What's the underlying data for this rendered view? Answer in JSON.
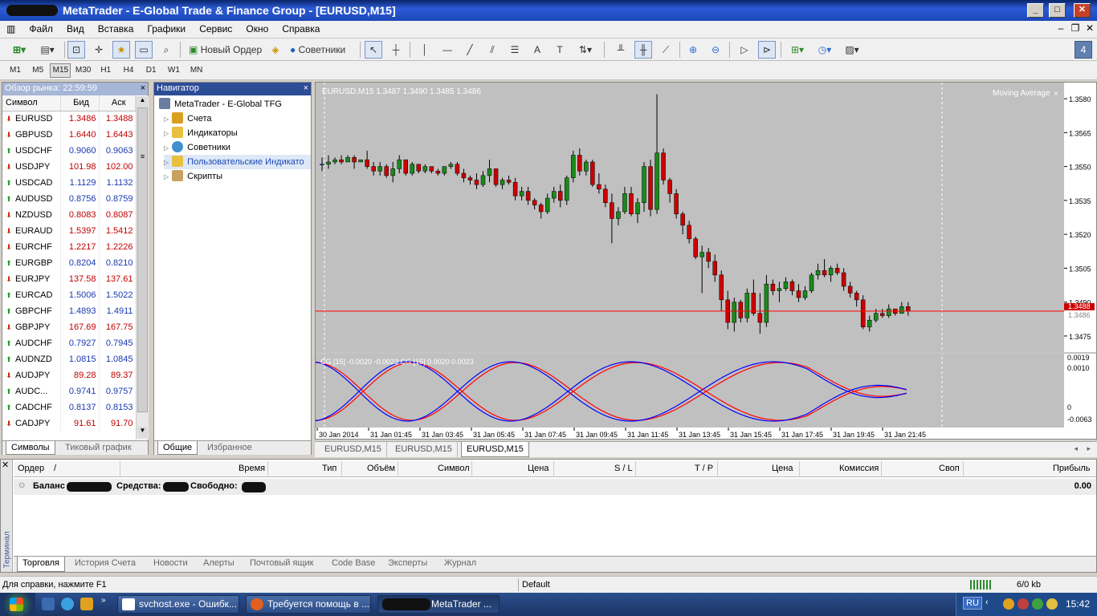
{
  "window": {
    "title": "MetaTrader - E-Global Trade & Finance Group - [EURUSD,M15]",
    "buttons": [
      "_",
      "□",
      "✕"
    ]
  },
  "menu": {
    "items": [
      "Файл",
      "Вид",
      "Вставка",
      "Графики",
      "Сервис",
      "Окно",
      "Справка"
    ],
    "mdi": [
      "–",
      "❐",
      "✕"
    ]
  },
  "toolbar": {
    "new_order": "Новый Ордер",
    "experts": "Советники",
    "badge": "4"
  },
  "periods": [
    "M1",
    "M5",
    "M15",
    "M30",
    "H1",
    "H4",
    "D1",
    "W1",
    "MN"
  ],
  "active_period": "M15",
  "market_watch": {
    "title": "Обзор рынка: 22:59:59",
    "close": "×",
    "columns": [
      "Символ",
      "Бид",
      "Аск"
    ],
    "rows": [
      {
        "dir": "down",
        "symbol": "EURUSD",
        "bid": "1.3486",
        "ask": "1.3488"
      },
      {
        "dir": "down",
        "symbol": "GBPUSD",
        "bid": "1.6440",
        "ask": "1.6443"
      },
      {
        "dir": "up",
        "symbol": "USDCHF",
        "bid": "0.9060",
        "ask": "0.9063"
      },
      {
        "dir": "down",
        "symbol": "USDJPY",
        "bid": "101.98",
        "ask": "102.00"
      },
      {
        "dir": "up",
        "symbol": "USDCAD",
        "bid": "1.1129",
        "ask": "1.1132"
      },
      {
        "dir": "up",
        "symbol": "AUDUSD",
        "bid": "0.8756",
        "ask": "0.8759"
      },
      {
        "dir": "down",
        "symbol": "NZDUSD",
        "bid": "0.8083",
        "ask": "0.8087"
      },
      {
        "dir": "down",
        "symbol": "EURAUD",
        "bid": "1.5397",
        "ask": "1.5412"
      },
      {
        "dir": "down",
        "symbol": "EURCHF",
        "bid": "1.2217",
        "ask": "1.2226"
      },
      {
        "dir": "up",
        "symbol": "EURGBP",
        "bid": "0.8204",
        "ask": "0.8210"
      },
      {
        "dir": "down",
        "symbol": "EURJPY",
        "bid": "137.58",
        "ask": "137.61"
      },
      {
        "dir": "up",
        "symbol": "EURCAD",
        "bid": "1.5006",
        "ask": "1.5022"
      },
      {
        "dir": "up",
        "symbol": "GBPCHF",
        "bid": "1.4893",
        "ask": "1.4911"
      },
      {
        "dir": "down",
        "symbol": "GBPJPY",
        "bid": "167.69",
        "ask": "167.75"
      },
      {
        "dir": "up",
        "symbol": "AUDCHF",
        "bid": "0.7927",
        "ask": "0.7945"
      },
      {
        "dir": "up",
        "symbol": "AUDNZD",
        "bid": "1.0815",
        "ask": "1.0845"
      },
      {
        "dir": "down",
        "symbol": "AUDJPY",
        "bid": "89.28",
        "ask": "89.37"
      },
      {
        "dir": "up",
        "symbol": "AUDC...",
        "bid": "0.9741",
        "ask": "0.9757"
      },
      {
        "dir": "up",
        "symbol": "CADCHF",
        "bid": "0.8137",
        "ask": "0.8153"
      },
      {
        "dir": "down",
        "symbol": "CADJPY",
        "bid": "91.61",
        "ask": "91.70"
      }
    ],
    "tabs": [
      "Символы",
      "Тиковый график"
    ]
  },
  "navigator": {
    "title": "Навигатор",
    "close": "×",
    "root": "MetaTrader - E-Global TFG",
    "items": [
      "Счета",
      "Индикаторы",
      "Советники",
      "Пользовательские Индикато",
      "Скрипты"
    ],
    "tabs": [
      "Общие",
      "Избранное"
    ]
  },
  "chart": {
    "header": "EURUSD,M15  1.3487 1.3490 1.3485 1.3486",
    "indicator_label": "Moving Average",
    "osc_label": "CG [15] -0.0020 -0.0023  CG [15] 0.0020 0.0023",
    "price_ticks": [
      "1.3580",
      "1.3565",
      "1.3550",
      "1.3535",
      "1.3520",
      "1.3505",
      "1.3490",
      "1.3475"
    ],
    "bid_label": "1.3488",
    "ask_label": "1.3486",
    "osc_ticks": [
      "0.0019",
      "0.0010",
      "0",
      "-0.0063"
    ],
    "time_ticks": [
      "30 Jan 2014",
      "31 Jan 01:45",
      "31 Jan 03:45",
      "31 Jan 05:45",
      "31 Jan 07:45",
      "31 Jan 09:45",
      "31 Jan 11:45",
      "31 Jan 13:45",
      "31 Jan 15:45",
      "31 Jan 17:45",
      "31 Jan 19:45",
      "31 Jan 21:45"
    ],
    "colors": {
      "bull": "#1a8a1a",
      "bear": "#cc0000",
      "bg": "#c0c0c0",
      "osc_red": "#ff0000",
      "osc_blue": "#0000ff",
      "bidline": "#ff0000"
    }
  },
  "chart_data": {
    "type": "candlestick",
    "symbol": "EURUSD",
    "timeframe": "M15",
    "ylim": [
      1.347,
      1.3585
    ],
    "last_close": 1.3486,
    "ohlc": [
      [
        1.3551,
        1.3554,
        1.3548,
        1.3551
      ],
      [
        1.3551,
        1.3555,
        1.3549,
        1.3552
      ],
      [
        1.3552,
        1.3554,
        1.3551,
        1.3553
      ],
      [
        1.3553,
        1.3555,
        1.3551,
        1.3552
      ],
      [
        1.3552,
        1.3555,
        1.3552,
        1.3554
      ],
      [
        1.3554,
        1.3555,
        1.3549,
        1.3552
      ],
      [
        1.3552,
        1.3553,
        1.3552,
        1.3553
      ],
      [
        1.3553,
        1.3557,
        1.3549,
        1.355
      ],
      [
        1.355,
        1.3552,
        1.3546,
        1.3548
      ],
      [
        1.3548,
        1.3552,
        1.3546,
        1.355
      ],
      [
        1.355,
        1.3551,
        1.3545,
        1.3546
      ],
      [
        1.3546,
        1.3552,
        1.3543,
        1.3549
      ],
      [
        1.3549,
        1.3555,
        1.3547,
        1.3553
      ],
      [
        1.3553,
        1.3553,
        1.3546,
        1.3547
      ],
      [
        1.3547,
        1.3552,
        1.3546,
        1.3551
      ],
      [
        1.3551,
        1.3551,
        1.3547,
        1.3548
      ],
      [
        1.3548,
        1.3551,
        1.3547,
        1.355
      ],
      [
        1.355,
        1.355,
        1.3547,
        1.3548
      ],
      [
        1.3548,
        1.3549,
        1.3546,
        1.3547
      ],
      [
        1.3547,
        1.355,
        1.3546,
        1.355
      ],
      [
        1.355,
        1.3552,
        1.3549,
        1.3551
      ],
      [
        1.3551,
        1.3552,
        1.3546,
        1.3547
      ],
      [
        1.3547,
        1.3549,
        1.3543,
        1.3545
      ],
      [
        1.3545,
        1.3546,
        1.3542,
        1.3544
      ],
      [
        1.3544,
        1.3547,
        1.354,
        1.3542
      ],
      [
        1.3542,
        1.3548,
        1.3541,
        1.3546
      ],
      [
        1.3546,
        1.3553,
        1.3543,
        1.3549
      ],
      [
        1.3549,
        1.3549,
        1.3541,
        1.3542
      ],
      [
        1.3542,
        1.3545,
        1.354,
        1.3544
      ],
      [
        1.3544,
        1.3546,
        1.3542,
        1.3543
      ],
      [
        1.3543,
        1.3545,
        1.3535,
        1.3537
      ],
      [
        1.3537,
        1.3541,
        1.3535,
        1.3539
      ],
      [
        1.3539,
        1.3541,
        1.3533,
        1.3535
      ],
      [
        1.3535,
        1.3536,
        1.3531,
        1.3533
      ],
      [
        1.3533,
        1.3534,
        1.3527,
        1.353
      ],
      [
        1.353,
        1.3538,
        1.3529,
        1.3536
      ],
      [
        1.3536,
        1.3541,
        1.3534,
        1.3539
      ],
      [
        1.3539,
        1.3542,
        1.3532,
        1.3535
      ],
      [
        1.3535,
        1.3546,
        1.3533,
        1.3545
      ],
      [
        1.3545,
        1.3557,
        1.3543,
        1.3555
      ],
      [
        1.3555,
        1.3558,
        1.3546,
        1.3548
      ],
      [
        1.3548,
        1.3553,
        1.3546,
        1.3552
      ],
      [
        1.3552,
        1.3553,
        1.3541,
        1.3542
      ],
      [
        1.3542,
        1.3547,
        1.3538,
        1.354
      ],
      [
        1.354,
        1.3542,
        1.3532,
        1.3534
      ],
      [
        1.3534,
        1.3538,
        1.3516,
        1.3527
      ],
      [
        1.3527,
        1.3532,
        1.3524,
        1.353
      ],
      [
        1.353,
        1.3541,
        1.3529,
        1.3538
      ],
      [
        1.3538,
        1.3541,
        1.3528,
        1.3529
      ],
      [
        1.3529,
        1.3536,
        1.3525,
        1.3534
      ],
      [
        1.3534,
        1.3552,
        1.353,
        1.355
      ],
      [
        1.355,
        1.3553,
        1.3528,
        1.3531
      ],
      [
        1.3531,
        1.3582,
        1.3529,
        1.3556
      ],
      [
        1.3556,
        1.3558,
        1.3542,
        1.3544
      ],
      [
        1.3544,
        1.3545,
        1.3534,
        1.3538
      ],
      [
        1.3538,
        1.354,
        1.3527,
        1.3529
      ],
      [
        1.3529,
        1.353,
        1.352,
        1.3524
      ],
      [
        1.3524,
        1.3526,
        1.3516,
        1.3518
      ],
      [
        1.3518,
        1.3519,
        1.3509,
        1.351
      ],
      [
        1.351,
        1.3515,
        1.3494,
        1.3512
      ],
      [
        1.3512,
        1.3514,
        1.3505,
        1.3508
      ],
      [
        1.3508,
        1.3511,
        1.3499,
        1.3502
      ],
      [
        1.3502,
        1.3504,
        1.3486,
        1.3491
      ],
      [
        1.3491,
        1.3495,
        1.3478,
        1.3481
      ],
      [
        1.3481,
        1.3492,
        1.3477,
        1.349
      ],
      [
        1.349,
        1.3491,
        1.3481,
        1.3483
      ],
      [
        1.3483,
        1.3496,
        1.3481,
        1.3494
      ],
      [
        1.3494,
        1.35,
        1.3484,
        1.3485
      ],
      [
        1.3485,
        1.3494,
        1.3476,
        1.3481
      ],
      [
        1.3481,
        1.3502,
        1.3479,
        1.3498
      ],
      [
        1.3498,
        1.35,
        1.3493,
        1.3495
      ],
      [
        1.3495,
        1.3499,
        1.349,
        1.3496
      ],
      [
        1.3496,
        1.3501,
        1.3495,
        1.3499
      ],
      [
        1.3499,
        1.35,
        1.3493,
        1.3495
      ],
      [
        1.3495,
        1.3498,
        1.349,
        1.3492
      ],
      [
        1.3492,
        1.3497,
        1.3491,
        1.3495
      ],
      [
        1.3495,
        1.3503,
        1.3494,
        1.3502
      ],
      [
        1.3502,
        1.3507,
        1.35,
        1.3504
      ],
      [
        1.3504,
        1.3509,
        1.3501,
        1.3502
      ],
      [
        1.3502,
        1.3506,
        1.3499,
        1.3505
      ],
      [
        1.3505,
        1.3507,
        1.3502,
        1.3503
      ],
      [
        1.3503,
        1.3505,
        1.3495,
        1.3497
      ],
      [
        1.3497,
        1.3499,
        1.3492,
        1.3494
      ],
      [
        1.3494,
        1.3495,
        1.3488,
        1.3491
      ],
      [
        1.3491,
        1.3493,
        1.3478,
        1.3479
      ],
      [
        1.3479,
        1.3484,
        1.3477,
        1.3482
      ],
      [
        1.3482,
        1.3487,
        1.3481,
        1.3485
      ],
      [
        1.3485,
        1.3487,
        1.3483,
        1.3484
      ],
      [
        1.3484,
        1.3489,
        1.3483,
        1.3487
      ],
      [
        1.3487,
        1.3487,
        1.3484,
        1.3485
      ],
      [
        1.3485,
        1.349,
        1.3485,
        1.3488
      ],
      [
        1.3488,
        1.349,
        1.3484,
        1.3486
      ]
    ]
  },
  "chart_tabs": [
    "EURUSD,M15",
    "EURUSD,M15",
    "EURUSD,M15"
  ],
  "terminal": {
    "side_label": "Терминал",
    "columns": [
      "Ордер",
      "/",
      "Время",
      "Тип",
      "Объём",
      "Символ",
      "Цена",
      "S / L",
      "T / P",
      "Цена",
      "Комиссия",
      "Своп",
      "Прибыль"
    ],
    "balance_label": "Баланс",
    "equity_label": "Средства:",
    "free_label": "Свободно:",
    "profit": "0.00",
    "tabs": [
      "Торговля",
      "История Счета",
      "Новости",
      "Алерты",
      "Почтовый ящик",
      "Code Base",
      "Эксперты",
      "Журнал"
    ]
  },
  "status": {
    "help": "Для справки, нажмите F1",
    "profile": "Default",
    "traffic": "6/0 kb"
  },
  "taskbar": {
    "buttons": [
      "svchost.exe - Ошибк...",
      "Требуется помощь в ...",
      "MetaTrader ..."
    ],
    "lang": "RU",
    "time": "15:42"
  }
}
